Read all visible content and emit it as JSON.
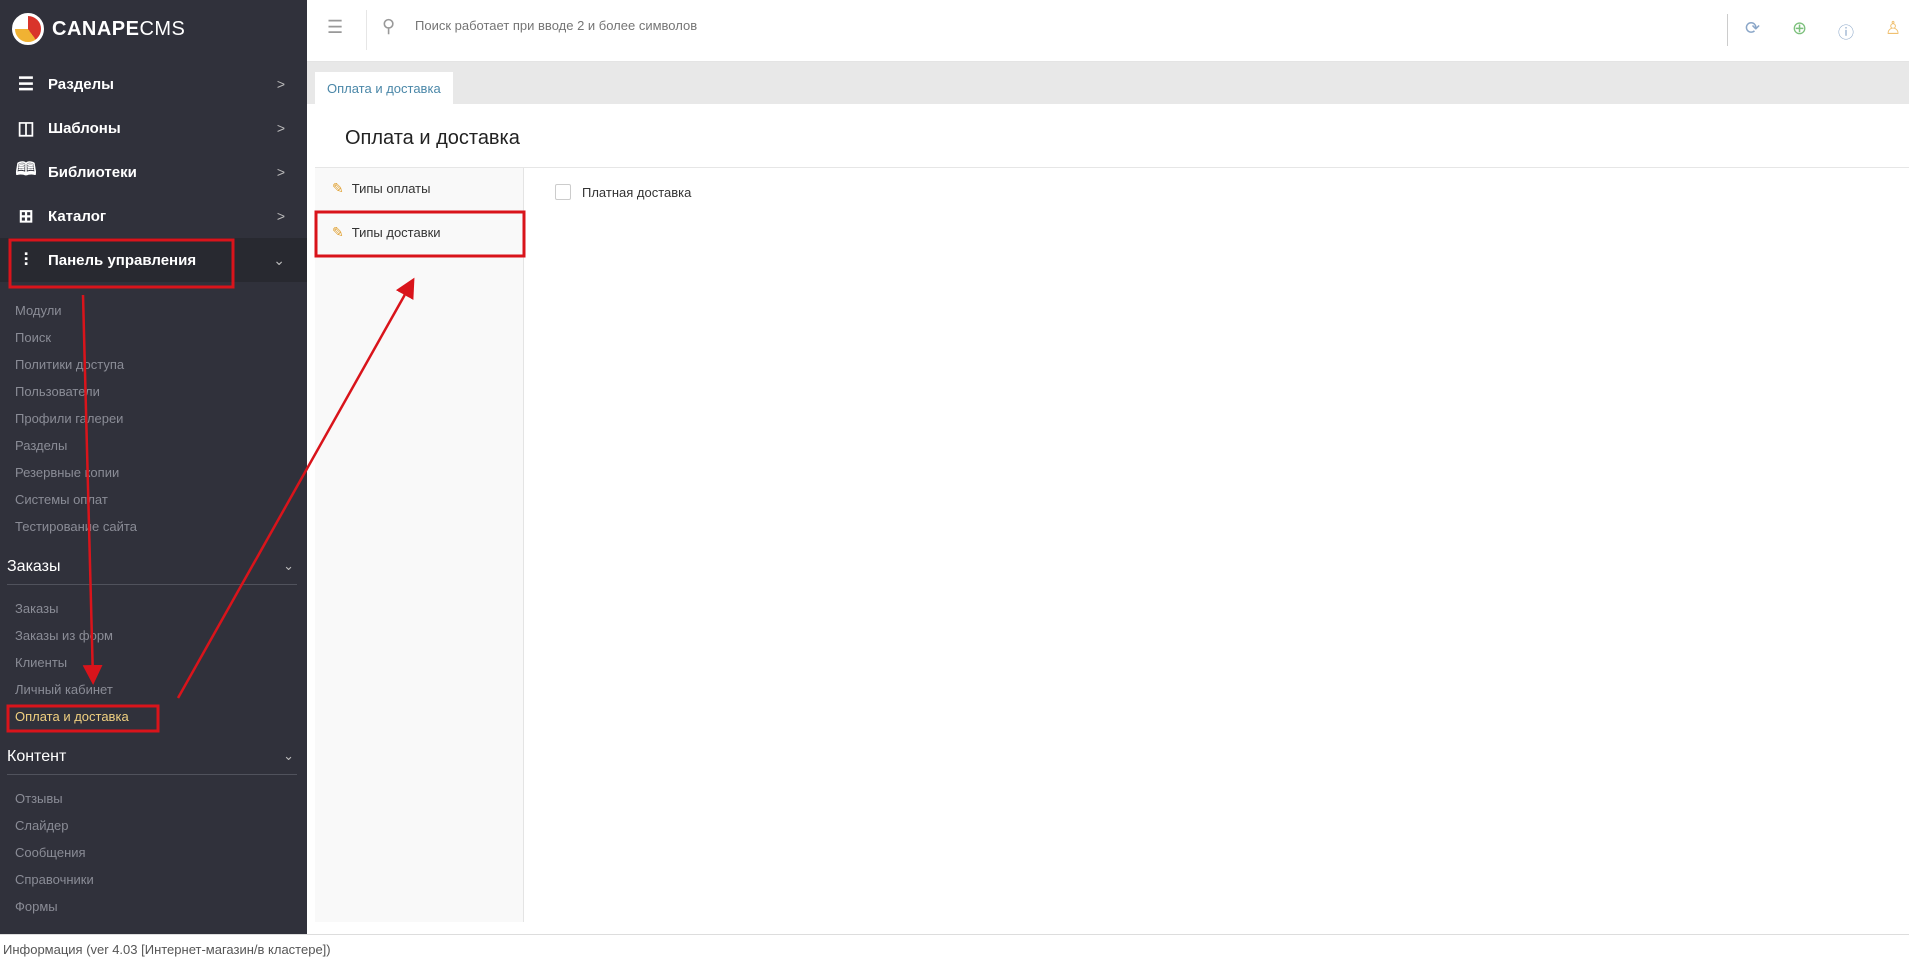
{
  "brand": {
    "bold": "CANAPE",
    "light": "CMS"
  },
  "sidebar": {
    "menu": [
      {
        "label": "Разделы",
        "icon": "list-icon"
      },
      {
        "label": "Шаблоны",
        "icon": "layout-icon"
      },
      {
        "label": "Библиотеки",
        "icon": "book-icon"
      },
      {
        "label": "Каталог",
        "icon": "grid-icon"
      },
      {
        "label": "Панель управления",
        "icon": "sliders-icon"
      }
    ],
    "panel_items": [
      "Модули",
      "Поиск",
      "Политики доступа",
      "Пользователи",
      "Профили галереи",
      "Разделы",
      "Резервные копии",
      "Системы оплат",
      "Тестирование сайта"
    ],
    "orders": {
      "title": "Заказы",
      "items": [
        "Заказы",
        "Заказы из форм",
        "Клиенты",
        "Личный кабинет",
        "Оплата и доставка"
      ]
    },
    "content": {
      "title": "Контент",
      "items": [
        "Отзывы",
        "Слайдер",
        "Сообщения",
        "Справочники",
        "Формы"
      ]
    }
  },
  "topbar": {
    "search_placeholder": "Поиск работает при вводе 2 и более символов"
  },
  "tab": {
    "label": "Оплата и доставка"
  },
  "page": {
    "title": "Оплата и доставка",
    "nav": [
      "Типы оплаты",
      "Типы доставки"
    ],
    "checkbox_label": "Платная доставка",
    "checkbox_checked": false
  },
  "footer": {
    "text": "Информация (ver 4.03 [Интернет-магазин/в кластере])"
  },
  "colors": {
    "sidebar": "#30313b",
    "accent": "#f0d080",
    "annotation": "#d9141b"
  }
}
